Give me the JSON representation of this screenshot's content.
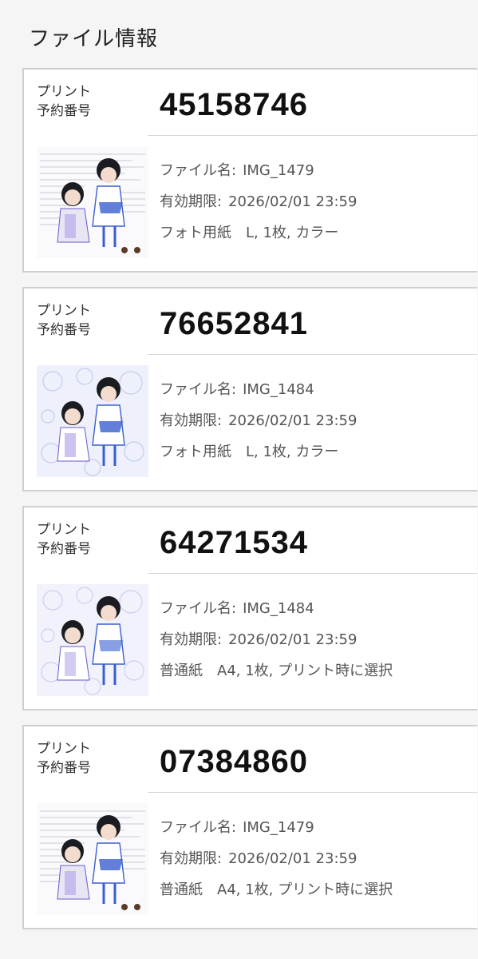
{
  "page": {
    "title": "ファイル情報"
  },
  "cards": [
    {
      "label_line1": "プリント",
      "label_line2": "予約番号",
      "number": "45158746",
      "file_name_key": "ファイル名:",
      "file_name": "IMG_1479",
      "expiry_key": "有効期限:",
      "expiry": "2026/02/01 23:59",
      "paper_type": "フォト用紙",
      "paper_spec": "L, 1枚, カラー",
      "thumbnail": "illustration-with-handwritten-text"
    },
    {
      "label_line1": "プリント",
      "label_line2": "予約番号",
      "number": "76652841",
      "file_name_key": "ファイル名:",
      "file_name": "IMG_1484",
      "expiry_key": "有効期限:",
      "expiry": "2026/02/01 23:59",
      "paper_type": "フォト用紙",
      "paper_spec": "L, 1枚, カラー",
      "thumbnail": "illustration-with-flower-background"
    },
    {
      "label_line1": "プリント",
      "label_line2": "予約番号",
      "number": "64271534",
      "file_name_key": "ファイル名:",
      "file_name": "IMG_1484",
      "expiry_key": "有効期限:",
      "expiry": "2026/02/01 23:59",
      "paper_type": "普通紙",
      "paper_spec": "A4, 1枚, プリント時に選択",
      "thumbnail": "illustration-with-flower-background"
    },
    {
      "label_line1": "プリント",
      "label_line2": "予約番号",
      "number": "07384860",
      "file_name_key": "ファイル名:",
      "file_name": "IMG_1479",
      "expiry_key": "有効期限:",
      "expiry": "2026/02/01 23:59",
      "paper_type": "普通紙",
      "paper_spec": "A4, 1枚, プリント時に選択",
      "thumbnail": "illustration-with-handwritten-text"
    }
  ],
  "colors": {
    "background": "#f5f5f5",
    "card": "#ffffff",
    "border": "#cfcfcf",
    "accent_purple": "#6a5acd",
    "accent_blue": "#3b5fd0"
  }
}
